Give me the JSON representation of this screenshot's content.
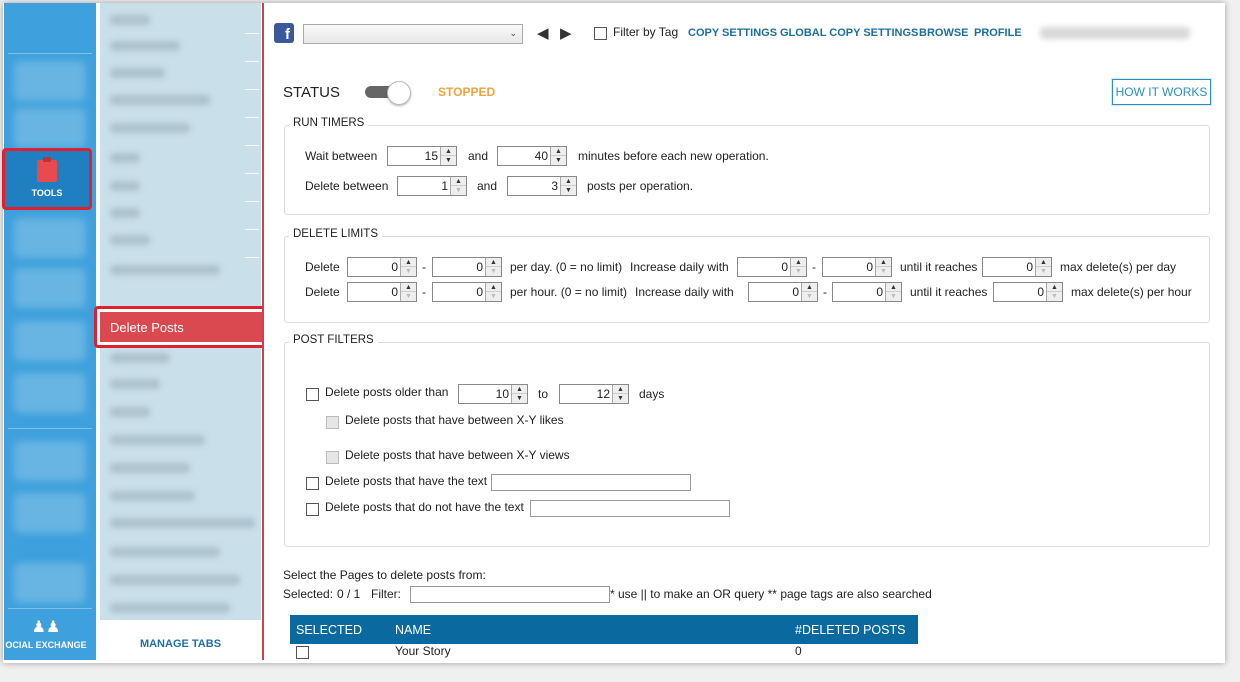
{
  "rail": {
    "tools_label": "TOOLS",
    "social_exchange_label": "OCIAL EXCHANGE"
  },
  "subnav": {
    "active_item": "Delete Posts",
    "manage_tabs": "MANAGE TABS"
  },
  "topbar": {
    "filter_by_tag": "Filter by Tag",
    "links": [
      "COPY SETTINGS",
      "GLOBAL COPY SETTINGS",
      "BROWSE",
      "PROFILE"
    ],
    "prev_icon": "triangle-left-icon",
    "next_icon": "triangle-right-icon"
  },
  "status": {
    "label": "STATUS",
    "state": "STOPPED",
    "how_it_works": "HOW IT WORKS"
  },
  "run_timers": {
    "title": "RUN TIMERS",
    "wait_label": "Wait between",
    "wait_min": "15",
    "and1": "and",
    "wait_max": "40",
    "wait_suffix": "minutes before each new operation.",
    "delete_label": "Delete between",
    "delete_min": "1",
    "and2": "and",
    "delete_max": "3",
    "delete_suffix": "posts per operation."
  },
  "delete_limits": {
    "title": "DELETE LIMITS",
    "row1": {
      "label": "Delete",
      "from": "0",
      "dash": "-",
      "to": "0",
      "per": "per day. (0 = no limit)",
      "increase": "Increase daily with",
      "inc_from": "0",
      "dash2": "-",
      "inc_to": "0",
      "until": "until it reaches",
      "max": "0",
      "max_label": "max delete(s) per day"
    },
    "row2": {
      "label": "Delete",
      "from": "0",
      "dash": "-",
      "to": "0",
      "per": "per hour. (0 = no limit)",
      "increase": "Increase daily with",
      "inc_from": "0",
      "dash2": "-",
      "inc_to": "0",
      "until": "until it reaches",
      "max": "0",
      "max_label": "max delete(s) per hour"
    }
  },
  "post_filters": {
    "title": "POST FILTERS",
    "older_label": "Delete posts older than",
    "older_from": "10",
    "to": "to",
    "older_to": "12",
    "days": "days",
    "likes_label": "Delete posts that have between X-Y likes",
    "views_label": "Delete posts that have between X-Y views",
    "has_text_label": "Delete posts that have the text",
    "not_text_label": "Delete posts that do not have the text"
  },
  "pages": {
    "select_label": "Select the Pages to delete posts from:",
    "selected_label": "Selected:",
    "selected_count": "0 / 1",
    "filter_label": "Filter:",
    "filter_hint": "* use || to make an OR query ** page tags are also searched",
    "columns": [
      "SELECTED",
      "NAME",
      "#DELETED POSTS"
    ],
    "rows": [
      {
        "name": "Your Story",
        "deleted": "0"
      }
    ]
  }
}
